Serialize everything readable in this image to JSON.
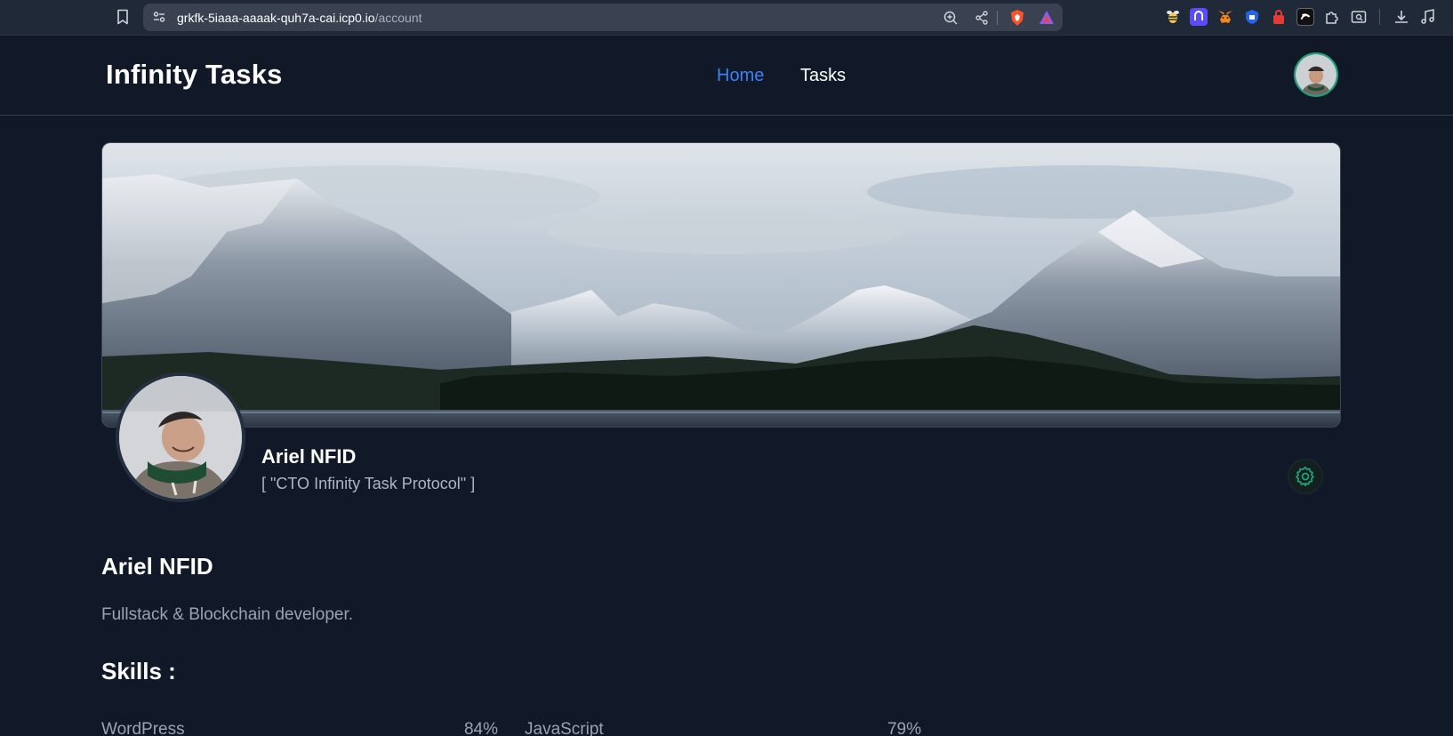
{
  "browser": {
    "url_host": "grkfk-5iaaa-aaaak-quh7a-cai.icp0.io",
    "url_path": "/account",
    "extensions": [
      "bee-icon",
      "purple-app-icon",
      "metamask-fox-icon",
      "shield-icon",
      "red-lock-icon",
      "dark-app-icon",
      "puzzle-icon",
      "screen-search-icon"
    ]
  },
  "header": {
    "brand": "Infinity Tasks",
    "nav": {
      "home": "Home",
      "tasks": "Tasks"
    }
  },
  "profile": {
    "name": "Ariel NFID",
    "title": "[ \"CTO Infinity Task Protocol\" ]"
  },
  "about": {
    "name": "Ariel NFID",
    "bio": "Fullstack & Blockchain developer."
  },
  "skills": {
    "heading": "Skills :",
    "items": [
      {
        "label": "WordPress",
        "percent": "84%"
      },
      {
        "label": "JavaScript",
        "percent": "79%"
      }
    ]
  },
  "colors": {
    "background": "#111827",
    "accent_blue": "#3b82f6",
    "accent_green": "#1aa57a"
  }
}
